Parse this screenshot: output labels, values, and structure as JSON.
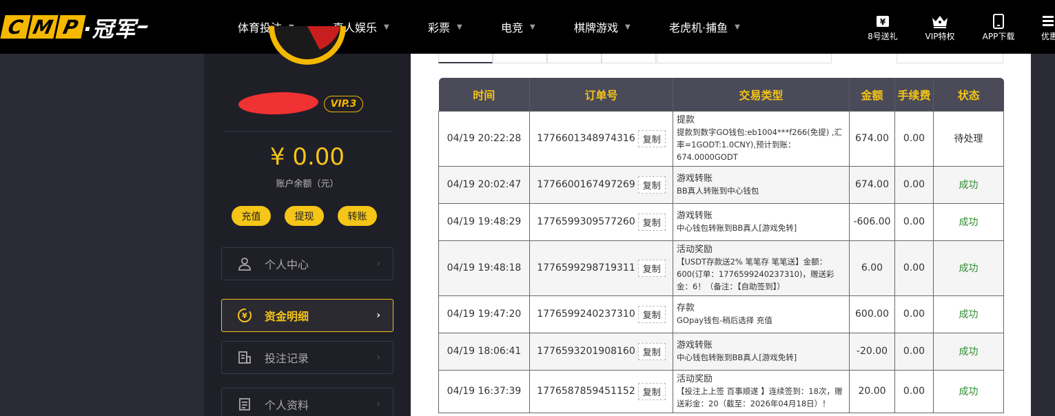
{
  "logo": {
    "letters": [
      "C",
      "M",
      "P"
    ],
    "brand": "·冠军"
  },
  "nav": [
    {
      "label": "体育投注"
    },
    {
      "label": "真人娱乐"
    },
    {
      "label": "彩票"
    },
    {
      "label": "电竞"
    },
    {
      "label": "棋牌游戏"
    },
    {
      "label": "老虎机·捕鱼"
    }
  ],
  "quick_links": [
    {
      "label": "8号送礼",
      "icon": "gift-ticket-icon"
    },
    {
      "label": "VIP特权",
      "icon": "crown-icon"
    },
    {
      "label": "APP下载",
      "icon": "phone-icon"
    },
    {
      "label": "优惠",
      "icon": "promo-icon"
    }
  ],
  "sidebar": {
    "vip_level": "VIP.3",
    "balance": "¥ 0.00",
    "balance_label": "账户余额（元）",
    "actions": {
      "deposit": "充值",
      "withdraw": "提现",
      "transfer": "转账"
    },
    "menu": [
      {
        "label": "个人中心",
        "icon": "user-icon",
        "active": false
      },
      {
        "label": "资金明细",
        "icon": "yen-coin-icon",
        "active": true
      },
      {
        "label": "投注记录",
        "icon": "bet-record-icon",
        "active": false
      },
      {
        "label": "个人资料",
        "icon": "profile-doc-icon",
        "active": false
      }
    ]
  },
  "table": {
    "headers": [
      "时间",
      "订单号",
      "交易类型",
      "金额",
      "手续费",
      "状态"
    ],
    "copy_label": "复制",
    "rows": [
      {
        "time": "04/19 20:22:28",
        "order": "1776601348974316",
        "type_title": "提款",
        "type_desc": "提款到数字GO钱包:eb1004***f266(免提) ,汇率=1GODT:1.0CNY),预计到账：674.0000GODT",
        "amount": "674.00",
        "fee": "0.00",
        "status": "待处理",
        "status_kind": "pending"
      },
      {
        "time": "04/19 20:02:47",
        "order": "1776600167497269",
        "type_title": "游戏转账",
        "type_desc": "BB真人转账到中心钱包",
        "amount": "674.00",
        "fee": "0.00",
        "status": "成功",
        "status_kind": "ok"
      },
      {
        "time": "04/19 19:48:29",
        "order": "1776599309577260",
        "type_title": "游戏转账",
        "type_desc": "中心钱包转账到BB真人[游戏免转]",
        "amount": "-606.00",
        "fee": "0.00",
        "status": "成功",
        "status_kind": "ok"
      },
      {
        "time": "04/19 19:48:18",
        "order": "1776599298719311",
        "type_title": "活动奖励",
        "type_desc": "【USDT存款送2% 笔笔存 笔笔送】金额：600(订单：1776599240237310)，赠送彩金：6！（备注：【自助签到】）",
        "amount": "6.00",
        "fee": "0.00",
        "status": "成功",
        "status_kind": "ok"
      },
      {
        "time": "04/19 19:47:20",
        "order": "1776599240237310",
        "type_title": "存款",
        "type_desc": "GOpay钱包-稍后选择 充值",
        "amount": "600.00",
        "fee": "0.00",
        "status": "成功",
        "status_kind": "ok"
      },
      {
        "time": "04/19 18:06:41",
        "order": "1776593201908160",
        "type_title": "游戏转账",
        "type_desc": "中心钱包转账到BB真人[游戏免转]",
        "amount": "-20.00",
        "fee": "0.00",
        "status": "成功",
        "status_kind": "ok"
      },
      {
        "time": "04/19 16:37:39",
        "order": "1776587859451152",
        "type_title": "活动奖励",
        "type_desc": "【投注上上签 百事顺遂 】连续签到：18次，赠送彩金：20（截至：2026年04月18日）！",
        "amount": "20.00",
        "fee": "0.00",
        "status": "成功",
        "status_kind": "ok"
      }
    ]
  },
  "colors": {
    "accent": "#f5c518",
    "header_bg": "#000000",
    "sidebar_bg": "#1f1f28",
    "success": "#2e8b2e",
    "redaction": "#f03232"
  }
}
